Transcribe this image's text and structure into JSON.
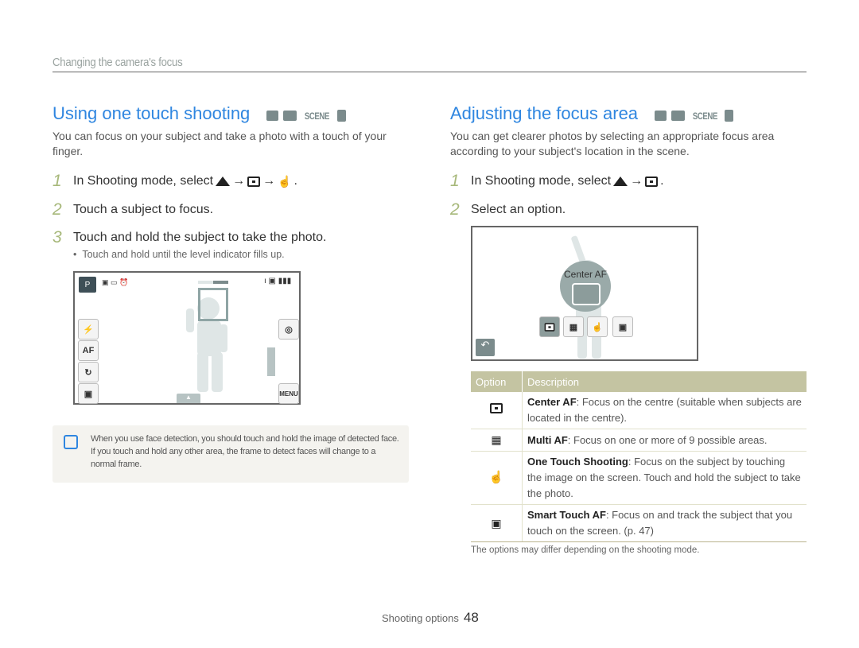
{
  "header": {
    "section": "Changing the camera's focus"
  },
  "left": {
    "title": "Using one touch shooting",
    "mode_icons": [
      "camera-icon",
      "program-mode-icon",
      "scene-mode-icon",
      "dual-is-icon"
    ],
    "scene_label": "SCENE",
    "intro": "You can focus on your subject and take a photo with a touch of your finger.",
    "steps": [
      {
        "num": "1",
        "text": "In Shooting mode, select",
        "icons": [
          "up-triangle-icon",
          "center-af-icon",
          "one-touch-icon"
        ]
      },
      {
        "num": "2",
        "text": "Touch a subject to focus."
      },
      {
        "num": "3",
        "text": "Touch and hold the subject to take the photo."
      }
    ],
    "bullet": "Touch and hold until the level indicator fills up.",
    "screen": {
      "left_buttons": [
        "flash-auto-icon",
        "af-icon",
        "timer-off-icon",
        "display-settings-icon"
      ],
      "af_label": "AF",
      "menu_label": "MENU",
      "level_indicator_fill": 0.5
    },
    "note": "When you use face detection, you should touch and hold the image of detected face. If you touch and hold any other area, the frame to detect faces will change to a normal frame."
  },
  "right": {
    "title": "Adjusting the focus area",
    "scene_label": "SCENE",
    "intro": "You can get clearer photos by selecting an appropriate focus area according to your subject's location in the scene.",
    "steps": [
      {
        "num": "1",
        "text": "In Shooting mode, select"
      },
      {
        "num": "2",
        "text": "Select an option."
      }
    ],
    "screen": {
      "selected_label": "Center AF"
    },
    "table": {
      "headers": [
        "Option",
        "Description"
      ],
      "rows": [
        {
          "icon": "center-af-icon",
          "name": "Center AF",
          "desc": ": Focus on the centre (suitable when subjects are located in the centre)."
        },
        {
          "icon": "multi-af-icon",
          "name": "Multi AF",
          "desc": ": Focus on one or more of 9 possible areas."
        },
        {
          "icon": "one-touch-icon",
          "name": "One Touch Shooting",
          "desc": ": Focus on the subject by touching the image on the screen. Touch and hold the subject to take the photo."
        },
        {
          "icon": "smart-touch-af-icon",
          "name": "Smart Touch AF",
          "desc": ": Focus on and track the subject that you touch on the screen. (p. 47)"
        }
      ]
    },
    "footnote": "The options may differ depending on the shooting mode."
  },
  "footer": {
    "label": "Shooting options",
    "page": "48"
  }
}
